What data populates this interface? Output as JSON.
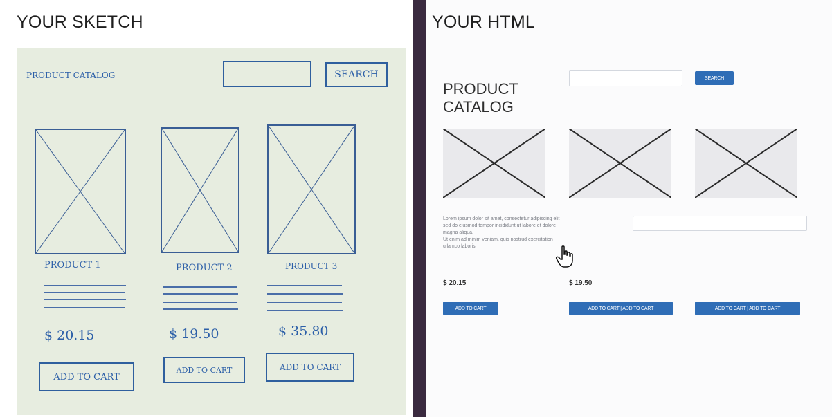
{
  "left": {
    "title": "YOUR SKETCH",
    "logo": "PRODUCT CATALOG",
    "search_button": "SEARCH",
    "products": [
      {
        "name": "PRODUCT 1",
        "price": "$ 20.15",
        "button": "ADD TO CART"
      },
      {
        "name": "PRODUCT 2",
        "price": "$ 19.50",
        "button": "ADD TO CART"
      },
      {
        "name": "PRODUCT 3",
        "price": "$ 35.80",
        "button": "ADD TO CART"
      }
    ]
  },
  "right": {
    "title": "YOUR HTML",
    "catalog_title": "PRODUCT CATALOG",
    "search_button": "SEARCH",
    "description_lines": [
      "Lorem ipsum dolor sit amet, consectetur adipiscing elit",
      "sed do eiusmod tempor incididunt ut labore et dolore",
      "magna aliqua.",
      "Ut enim ad minim veniam, quis nostrud exercitation",
      "ullamco laboris"
    ],
    "prices": [
      "$ 20.15",
      "$ 19.50"
    ],
    "cart_buttons": [
      "ADD TO CART",
      "ADD TO CART | ADD TO CART",
      "ADD TO CART | ADD TO CART"
    ]
  },
  "colors": {
    "sketch_ink": "#2c5fa8",
    "paper": "#e7ede0",
    "divider": "#3a2a3f",
    "button_blue": "#2f6db6"
  }
}
